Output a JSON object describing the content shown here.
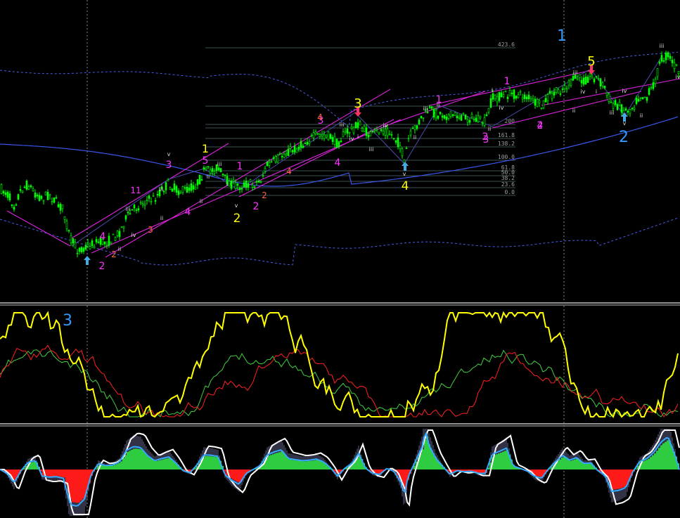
{
  "chart_data": [
    {
      "type": "candlestick",
      "panel": "price",
      "candle_colors": {
        "up": "#00ff00",
        "down": "#00ff00"
      },
      "price_path": [
        [
          0,
          268
        ],
        [
          10,
          275
        ],
        [
          20,
          292
        ],
        [
          30,
          270
        ],
        [
          40,
          262
        ],
        [
          50,
          275
        ],
        [
          60,
          282
        ],
        [
          70,
          276
        ],
        [
          80,
          288
        ],
        [
          90,
          298
        ],
        [
          100,
          340
        ],
        [
          110,
          355
        ],
        [
          120,
          352
        ],
        [
          130,
          348
        ],
        [
          140,
          344
        ],
        [
          150,
          345
        ],
        [
          160,
          340
        ],
        [
          170,
          330
        ],
        [
          180,
          310
        ],
        [
          190,
          298
        ],
        [
          200,
          290
        ],
        [
          210,
          285
        ],
        [
          220,
          282
        ],
        [
          230,
          270
        ],
        [
          240,
          262
        ],
        [
          250,
          270
        ],
        [
          260,
          272
        ],
        [
          270,
          268
        ],
        [
          280,
          262
        ],
        [
          290,
          245
        ],
        [
          300,
          242
        ],
        [
          310,
          238
        ],
        [
          320,
          255
        ],
        [
          330,
          262
        ],
        [
          340,
          265
        ],
        [
          350,
          262
        ],
        [
          360,
          262
        ],
        [
          370,
          258
        ],
        [
          380,
          235
        ],
        [
          390,
          230
        ],
        [
          400,
          222
        ],
        [
          410,
          215
        ],
        [
          420,
          212
        ],
        [
          430,
          206
        ],
        [
          440,
          198
        ],
        [
          450,
          193
        ],
        [
          460,
          192
        ],
        [
          470,
          195
        ],
        [
          480,
          205
        ],
        [
          490,
          190
        ],
        [
          500,
          185
        ],
        [
          510,
          176
        ],
        [
          520,
          188
        ],
        [
          530,
          192
        ],
        [
          540,
          185
        ],
        [
          550,
          186
        ],
        [
          560,
          195
        ],
        [
          570,
          208
        ],
        [
          575,
          233
        ],
        [
          580,
          200
        ],
        [
          590,
          182
        ],
        [
          600,
          168
        ],
        [
          610,
          156
        ],
        [
          620,
          162
        ],
        [
          630,
          163
        ],
        [
          640,
          165
        ],
        [
          650,
          164
        ],
        [
          660,
          167
        ],
        [
          670,
          168
        ],
        [
          680,
          171
        ],
        [
          690,
          174
        ],
        [
          700,
          140
        ],
        [
          710,
          138
        ],
        [
          720,
          135
        ],
        [
          730,
          134
        ],
        [
          740,
          136
        ],
        [
          750,
          138
        ],
        [
          760,
          146
        ],
        [
          770,
          152
        ],
        [
          780,
          137
        ],
        [
          790,
          132
        ],
        [
          800,
          126
        ],
        [
          810,
          120
        ],
        [
          820,
          110
        ],
        [
          830,
          115
        ],
        [
          840,
          108
        ],
        [
          850,
          112
        ],
        [
          860,
          125
        ],
        [
          870,
          148
        ],
        [
          880,
          150
        ],
        [
          890,
          158
        ],
        [
          900,
          152
        ],
        [
          910,
          135
        ],
        [
          920,
          138
        ],
        [
          930,
          120
        ],
        [
          940,
          85
        ],
        [
          950,
          78
        ],
        [
          960,
          95
        ],
        [
          967,
          100
        ]
      ],
      "wave_labels": [
        {
          "text": "1",
          "color": "#3399ff"
        },
        {
          "text": "5",
          "color": "#ffff00"
        },
        {
          "text": "3",
          "color": "#ffff00"
        },
        {
          "text": "1",
          "color": "#ffff00"
        },
        {
          "text": "2",
          "color": "#ffff00"
        },
        {
          "text": "4",
          "color": "#ffff00"
        },
        {
          "text": "2",
          "color": "#3399ff"
        },
        {
          "text": "3",
          "color": "#ff33ff"
        },
        {
          "text": "1",
          "color": "#ff33ff"
        },
        {
          "text": "3",
          "color": "#ff33ff"
        },
        {
          "text": "5",
          "color": "#ff33ff"
        },
        {
          "text": "1",
          "color": "#ff33ff"
        },
        {
          "text": "4",
          "color": "#ff33ff"
        },
        {
          "text": "2",
          "color": "#ff33ff"
        },
        {
          "text": "2",
          "color": "#ff33ff"
        },
        {
          "text": "4",
          "color": "#ff33ff"
        },
        {
          "text": "2",
          "color": "#ff33ff"
        },
        {
          "text": "4",
          "color": "#ff33ff"
        },
        {
          "text": "1",
          "color": "#ff33ff"
        },
        {
          "text": "3",
          "color": "#ff33ff"
        },
        {
          "text": "2",
          "color": "#ff33ff"
        },
        {
          "text": "4",
          "color": "#ff33ff"
        },
        {
          "text": "11",
          "color": "#ff33ff"
        },
        {
          "text": "3",
          "color": "#ff6633"
        },
        {
          "text": "4",
          "color": "#ff6633"
        },
        {
          "text": "2",
          "color": "#ff6633"
        },
        {
          "text": "2",
          "color": "#ff6633"
        },
        {
          "text": "4",
          "color": "#ff6633"
        },
        {
          "text": "3",
          "color": "#ff3333"
        }
      ],
      "fib_levels": [
        "423.6",
        "200",
        "161.8",
        "138.2",
        "100.0",
        "61.8",
        "50.0",
        "38.2",
        "23.6",
        "0.0"
      ]
    },
    {
      "type": "line",
      "panel": "oscillator",
      "wave_label": {
        "text": "3",
        "color": "#3399ff"
      },
      "series_colors": [
        "#ffff00",
        "#ff2020",
        "#40d040"
      ]
    },
    {
      "type": "histogram",
      "panel": "macd",
      "colors": {
        "positive": "#2ecc40",
        "negative": "#ff1a1a",
        "bars": "#b8b8ff",
        "signal": "#ffffff",
        "line": "#33aaff"
      }
    }
  ]
}
